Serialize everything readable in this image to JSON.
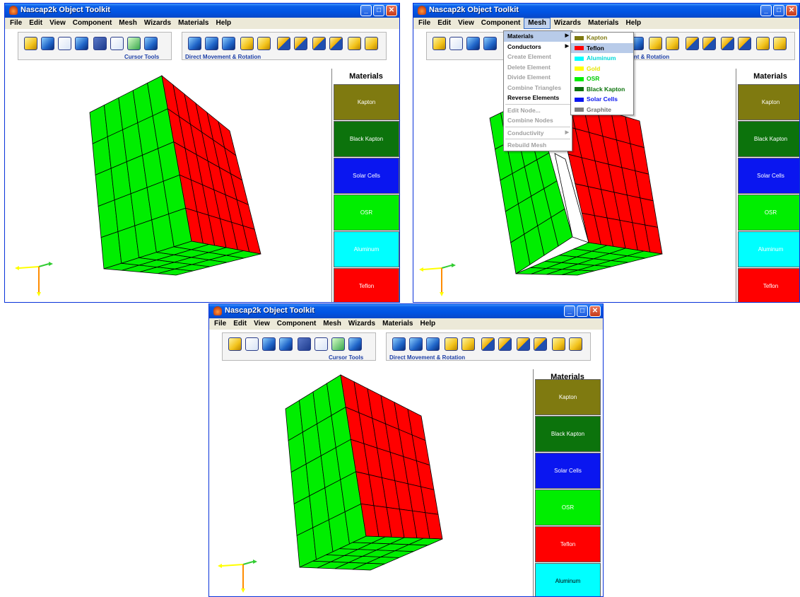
{
  "window": {
    "title": "Nascap2k Object Toolkit",
    "buttons": {
      "minimize": "_",
      "maximize": "□",
      "close": "✕"
    }
  },
  "menu": [
    "File",
    "Edit",
    "View",
    "Component",
    "Mesh",
    "Wizards",
    "Materials",
    "Help"
  ],
  "toolbar": {
    "cursor_tools_label": "Cursor Tools",
    "movement_label": "Direct Movement & Rotation"
  },
  "materials_panel": {
    "heading": "Materials",
    "order_a": [
      "Kapton",
      "Black Kapton",
      "Solar Cells",
      "OSR",
      "Aluminum",
      "Teflon"
    ],
    "order_b": [
      "Kapton",
      "Black Kapton",
      "Solar Cells",
      "OSR",
      "Teflon",
      "Aluminum"
    ]
  },
  "material_colors": {
    "Kapton": "#7f7a10",
    "Black Kapton": "#0c730c",
    "Solar Cells": "#0a16f0",
    "OSR": "#00ee00",
    "Aluminum": "#00ffff",
    "Teflon": "#ff0000",
    "Gold": "#ffff00",
    "Graphite": "#808080"
  },
  "mesh_menu": {
    "items": [
      {
        "label": "Materials",
        "state": "highlighted",
        "submenu": true
      },
      {
        "label": "Conductors",
        "state": "enabled",
        "submenu": true
      },
      {
        "label": "Create Element",
        "state": "disabled"
      },
      {
        "label": "Delete Element",
        "state": "disabled"
      },
      {
        "label": "Divide Element",
        "state": "disabled"
      },
      {
        "label": "Combine Triangles",
        "state": "disabled"
      },
      {
        "label": "Reverse Elements",
        "state": "enabled"
      },
      {
        "label": "Edit Node...",
        "state": "disabled"
      },
      {
        "label": "Combine Nodes",
        "state": "disabled"
      },
      {
        "label": "Conductivity",
        "state": "disabled",
        "submenu": true
      },
      {
        "label": "Rebuild Mesh",
        "state": "disabled"
      }
    ]
  },
  "materials_submenu": {
    "items": [
      {
        "label": "Kapton",
        "color": "#7f7a10",
        "text_color": "#7f7a10"
      },
      {
        "label": "Teflon",
        "color": "#ff0000",
        "text_color": "#000000",
        "state": "highlighted"
      },
      {
        "label": "Aluminum",
        "color": "#00ffff",
        "text_color": "#00d8d8"
      },
      {
        "label": "Gold",
        "color": "#ffff00",
        "text_color": "#e6e600"
      },
      {
        "label": "OSR",
        "color": "#00ee00",
        "text_color": "#00cc00"
      },
      {
        "label": "Black Kapton",
        "color": "#0c730c",
        "text_color": "#0c730c"
      },
      {
        "label": "Solar Cells",
        "color": "#0a16f0",
        "text_color": "#0a16f0"
      },
      {
        "label": "Graphite",
        "color": "#808080",
        "text_color": "#707070"
      }
    ]
  },
  "colors": {
    "face_left": "#00ee00",
    "face_right": "#ff0000",
    "edge": "#000000",
    "axis_yellow": "#ffff00",
    "axis_green": "#33cc33",
    "axis_orange": "#ff8c00"
  }
}
